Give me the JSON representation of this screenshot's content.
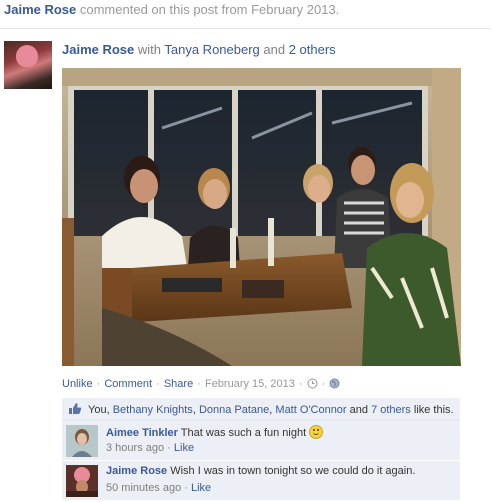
{
  "story_header": {
    "name": "Jaime Rose",
    "text": " commented on this post from February 2013."
  },
  "post": {
    "author": "Jaime Rose",
    "with_text": " with ",
    "tagged": "Tanya Roneberg",
    "and_text": " and ",
    "others": "2 others"
  },
  "actions": {
    "unlike": "Unlike",
    "comment": "Comment",
    "share": "Share",
    "date": "February 15, 2013",
    "sep": " · "
  },
  "likes": {
    "you": "You, ",
    "people": [
      "Bethany Knights",
      "Donna Patane",
      "Matt O'Connor"
    ],
    "comma": ", ",
    "and_text": " and ",
    "others": "7 others",
    "suffix": " like this."
  },
  "comments": [
    {
      "author": "Aimee Tinkler",
      "text": " That was such a fun night ",
      "time": "3 hours ago",
      "like": "Like"
    },
    {
      "author": "Jaime Rose",
      "text": " Wish I was in town tonight so we could do it again.",
      "time": "50 minutes ago",
      "like": "Like"
    }
  ],
  "colors": {
    "link": "#3b5998",
    "ufi_bg": "#eceff5",
    "meta_gray": "#999999"
  },
  "icons": [
    "thumbs-up-icon",
    "clock-icon",
    "globe-icon",
    "smile-emoticon-icon"
  ]
}
